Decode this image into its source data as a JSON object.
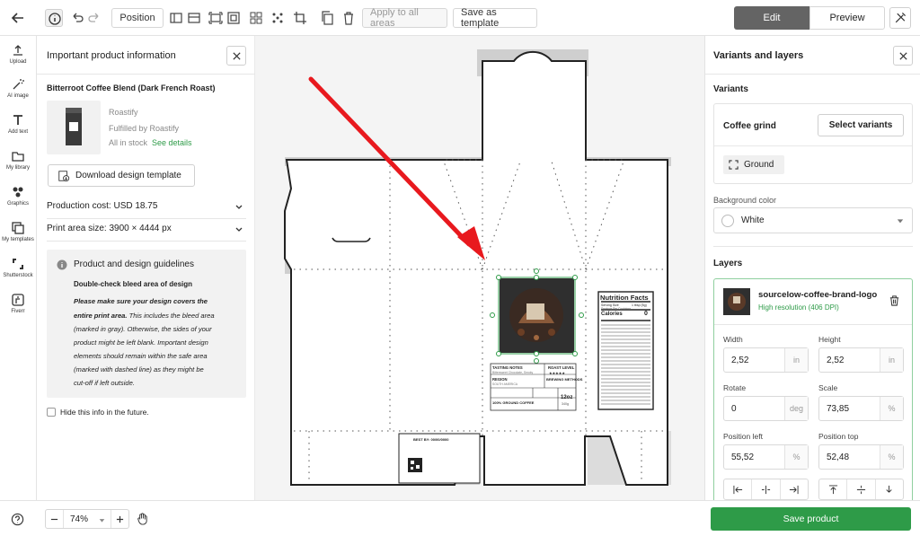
{
  "toolbar": {
    "position_label": "Position",
    "apply_all_label": "Apply to all areas",
    "save_template_label": "Save as template",
    "edit_label": "Edit",
    "preview_label": "Preview"
  },
  "sidebar": {
    "items": [
      {
        "label": "Upload",
        "icon": "upload-icon"
      },
      {
        "label": "AI image",
        "icon": "magic-wand-icon"
      },
      {
        "label": "Add text",
        "icon": "text-icon"
      },
      {
        "label": "My library",
        "icon": "folder-icon"
      },
      {
        "label": "Graphics",
        "icon": "graphics-icon"
      },
      {
        "label": "My templates",
        "icon": "templates-icon"
      },
      {
        "label": "Shutterstock",
        "icon": "shutterstock-icon"
      },
      {
        "label": "Fiverr",
        "icon": "fiverr-icon"
      }
    ]
  },
  "info": {
    "title": "Important product information",
    "product_name": "Bitterroot Coffee Blend (Dark French Roast)",
    "brand": "Roastify",
    "fulfilled": "Fulfilled by Roastify",
    "stock": "All in stock",
    "see_details": "See details",
    "download_label": "Download design template",
    "production_cost": "Production cost: USD 18.75",
    "print_area": "Print area size: 3900 × 4444 px",
    "guidelines_title": "Product and design guidelines",
    "guidelines_sub": "Double-check bleed area of design",
    "guidelines_line1": "Please make sure your design covers the",
    "guidelines_line2_bold": "entire print area.",
    "guidelines_line2_rest": " This includes the bleed area",
    "guidelines_line3": "(marked in gray). Otherwise, the sides of your",
    "guidelines_line4": "product might be left blank. Important design",
    "guidelines_line5": "elements should remain within the safe area",
    "guidelines_line6": "(marked with dashed line) as they might be",
    "guidelines_line7": "cut-off if left outside.",
    "hide_label": "Hide this info in the future."
  },
  "canvas": {
    "label_tasting": "TASTING NOTES",
    "label_tasting_sub": "Bittersweet Chocolate, Smoky",
    "label_roast": "ROAST LEVEL",
    "label_stars": "★★★★★",
    "label_region": "REGION",
    "label_region_sub": "SOUTH AMERICA",
    "label_brew": "BREWING METHODS",
    "label_ground": "100% GROUND COFFEE",
    "label_size": "12oz",
    "label_size_sub": "340g",
    "best_by": "BEST BY: 00/00/0000",
    "nutrition_title": "Nutrition Facts",
    "nutrition_serving": "Serving Size",
    "nutrition_serving_val": "1 tbsp (5g)",
    "nutrition_servings": "Servings Per Container",
    "nutrition_calories": "Calories",
    "nutrition_calories_val": "0"
  },
  "right": {
    "title": "Variants and layers",
    "variants_heading": "Variants",
    "grind_label": "Coffee grind",
    "select_variants_label": "Select variants",
    "ground_label": "Ground",
    "bg_color_label": "Background color",
    "bg_color_value": "White",
    "layers_heading": "Layers",
    "layer_name": "sourcelow-coffee-brand-logo",
    "layer_res": "High resolution (406 DPI)",
    "width_label": "Width",
    "width_value": "2,52",
    "width_unit": "in",
    "height_label": "Height",
    "height_value": "2,52",
    "height_unit": "in",
    "rotate_label": "Rotate",
    "rotate_value": "0",
    "rotate_unit": "deg",
    "scale_label": "Scale",
    "scale_value": "73,85",
    "scale_unit": "%",
    "posleft_label": "Position left",
    "posleft_value": "55,52",
    "posleft_unit": "%",
    "postop_label": "Position top",
    "postop_value": "52,48",
    "postop_unit": "%"
  },
  "bottom": {
    "zoom_value": "74%",
    "save_product_label": "Save product"
  },
  "colors": {
    "accent_green": "#2e9b48",
    "arrow_red": "#e8191e",
    "edit_bg": "#646464"
  }
}
